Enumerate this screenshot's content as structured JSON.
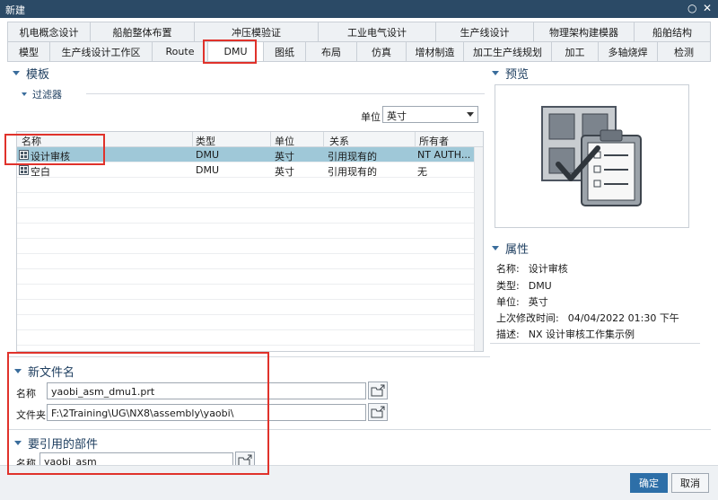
{
  "window": {
    "title": "新建",
    "restore_glyph": "○",
    "close_glyph": "✕"
  },
  "tabs_row1": [
    "机电概念设计",
    "船舶整体布置",
    "冲压模验证",
    "工业电气设计",
    "生产线设计",
    "物理架构建模器",
    "船舶结构"
  ],
  "tabs_row2": [
    "模型",
    "生产线设计工作区",
    "Route",
    "DMU",
    "图纸",
    "布局",
    "仿真",
    "增材制造",
    "加工生产线规划",
    "加工",
    "多轴烧焊",
    "检测"
  ],
  "active_tab": "DMU",
  "templates": {
    "title": "模板",
    "filter_title": "过滤器",
    "unit_label": "单位",
    "unit_value": "英寸",
    "columns": [
      "名称",
      "类型",
      "单位",
      "关系",
      "所有者"
    ],
    "rows": [
      {
        "name": "设计审核",
        "type": "DMU",
        "unit": "英寸",
        "relation": "引用现有的",
        "owner": "NT AUTH...",
        "selected": true
      },
      {
        "name": "空白",
        "type": "DMU",
        "unit": "英寸",
        "relation": "引用现有的",
        "owner": "无",
        "selected": false
      }
    ]
  },
  "preview": {
    "title": "预览"
  },
  "properties": {
    "title": "属性",
    "items": [
      {
        "label": "名称:",
        "value": "设计审核"
      },
      {
        "label": "类型:",
        "value": "DMU"
      },
      {
        "label": "单位:",
        "value": "英寸"
      },
      {
        "label": "上次修改时间:",
        "value": "04/04/2022 01:30 下午"
      },
      {
        "label": "描述:",
        "value": "NX 设计审核工作集示例"
      }
    ]
  },
  "new_file": {
    "title": "新文件名",
    "name_label": "名称",
    "name_value": "yaobi_asm_dmu1.prt",
    "folder_label": "文件夹",
    "folder_value": "F:\\2Training\\UG\\NX8\\assembly\\yaobi\\"
  },
  "ref_part": {
    "title": "要引用的部件",
    "name_label": "名称",
    "name_value": "yaobi_asm"
  },
  "buttons": {
    "ok": "确定",
    "cancel": "取消"
  },
  "colors": {
    "titlebar": "#2b4a66",
    "selected_row": "#9fc8d8",
    "primary_button": "#2d6fa8",
    "annotation_red": "#e0322b",
    "section_blue": "#1f3f60"
  }
}
